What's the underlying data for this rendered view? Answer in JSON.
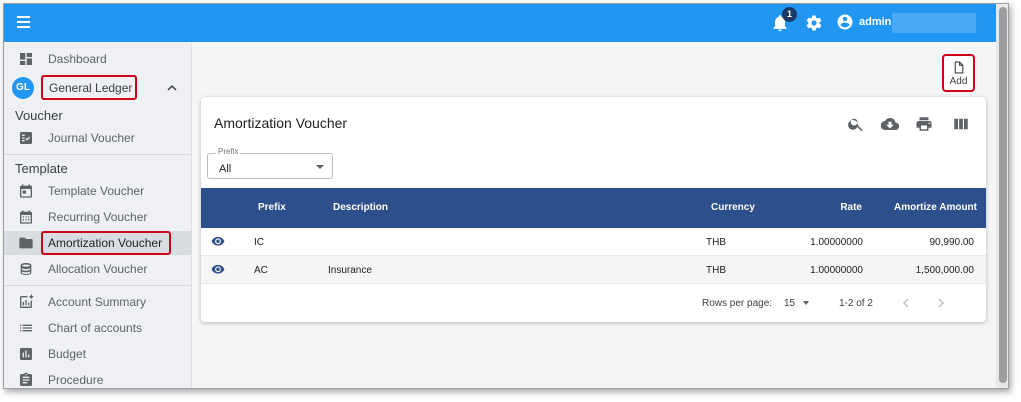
{
  "header": {
    "notification_count": "1",
    "user_name": "admin"
  },
  "sidebar": {
    "gl_avatar": "GL",
    "items": [
      {
        "label": "Dashboard"
      },
      {
        "label": "General Ledger"
      },
      {
        "label": "Journal Voucher"
      },
      {
        "label": "Template Voucher"
      },
      {
        "label": "Recurring Voucher"
      },
      {
        "label": "Amortization Voucher"
      },
      {
        "label": "Allocation Voucher"
      },
      {
        "label": "Account Summary"
      },
      {
        "label": "Chart of accounts"
      },
      {
        "label": "Budget"
      },
      {
        "label": "Procedure"
      }
    ],
    "sections": {
      "voucher": "Voucher",
      "template": "Template"
    }
  },
  "toolbar": {
    "add_label": "Add"
  },
  "card": {
    "title": "Amortization Voucher",
    "prefix_filter": {
      "label": "Prefix",
      "value": "All"
    }
  },
  "table": {
    "columns": [
      "Prefix",
      "Description",
      "Currency",
      "Rate",
      "Amortize Amount"
    ],
    "rows": [
      {
        "prefix": "IC",
        "description": "",
        "currency": "THB",
        "rate": "1.00000000",
        "amount": "90,990.00"
      },
      {
        "prefix": "AC",
        "description": "Insurance",
        "currency": "THB",
        "rate": "1.00000000",
        "amount": "1,500,000.00"
      }
    ]
  },
  "pagination": {
    "rows_per_page_label": "Rows per page:",
    "rows_per_page": "15",
    "range": "1-2 of 2"
  },
  "colors": {
    "topbar": "#2196f3",
    "table_header": "#2d4f8c",
    "highlight": "#d0021b"
  }
}
